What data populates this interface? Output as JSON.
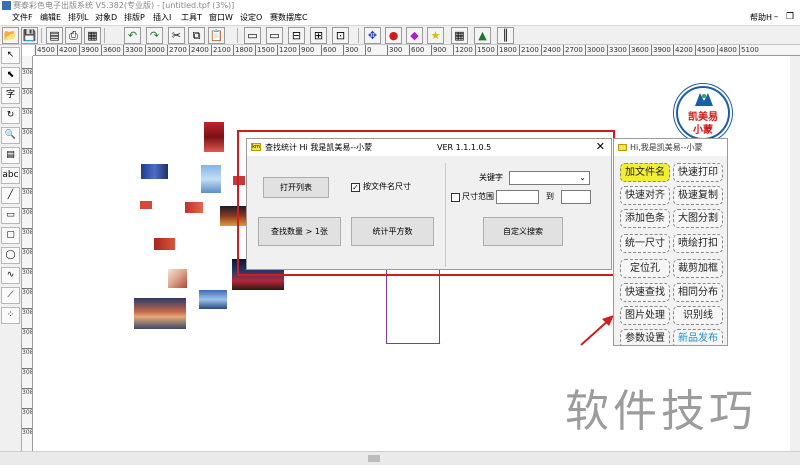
{
  "window": {
    "title": "赛泰彩色电子出版系统 V5.382(专业版) - [untitled.tpf (3%)]",
    "help_menu": "帮助H"
  },
  "menu": [
    "文件F",
    "编辑E",
    "排列L",
    "对象D",
    "排版P",
    "插入I",
    "工具T",
    "窗口W",
    "设定O",
    "赛数摆库C"
  ],
  "toolbar_icons": [
    "open-icon",
    "save-icon",
    "print-preview-icon",
    "print-icon",
    "undo-icon",
    "redo-icon",
    "cut-icon",
    "copy-icon",
    "paste-icon",
    "group-icon",
    "ungroup-icon",
    "align-icon",
    "arrange-icon",
    "move-icon",
    "color-icon",
    "fill-icon",
    "star-icon",
    "table-icon",
    "image-icon",
    "barcode-icon"
  ],
  "ruler": {
    "h_ticks": [
      "4500",
      "4200",
      "3900",
      "3600",
      "3300",
      "3000",
      "2700",
      "2400",
      "2100",
      "1800",
      "1500",
      "1200",
      "900",
      "600",
      "300",
      "0",
      "300",
      "600",
      "900",
      "1200",
      "1500",
      "1800",
      "2100",
      "2400",
      "2700",
      "3000",
      "3300",
      "3600",
      "3900",
      "4200",
      "4500",
      "4800",
      "5100"
    ],
    "v_ticks": [
      "308",
      "308",
      "308",
      "308",
      "308",
      "308",
      "308",
      "308",
      "308",
      "308",
      "308",
      "308",
      "308",
      "308",
      "308",
      "308",
      "308",
      "308",
      "308",
      "308"
    ]
  },
  "left_tools": [
    "arrow-icon",
    "select-icon",
    "text-icon",
    "rotate-icon",
    "zoom-icon",
    "page-icon",
    "abc-text-icon",
    "line-icon",
    "rectangle-icon",
    "rounded-rect-icon",
    "ellipse-icon",
    "wave-icon",
    "polyline-icon",
    "dotted-icon"
  ],
  "dialog": {
    "title": "查找统计 Hi 我是凯美易--小蒙",
    "version": "VER 1.1.1.0.5",
    "open_list_button": "打开列表",
    "by_filename_checkbox": "按文件名尺寸",
    "by_filename_checked": true,
    "count_button": "查找数量 > 1张",
    "area_button": "统计平方数",
    "keyword_label": "关键字",
    "keyword_value": "",
    "size_range_label": "尺寸范围 mm",
    "size_range_checked": false,
    "to_label": "到",
    "custom_search_button": "自定义搜索"
  },
  "panel": {
    "title": "Hi,我是凯美易--小蒙",
    "buttons": [
      {
        "label": "加文件名",
        "highlight": true
      },
      {
        "label": "快速打印"
      },
      {
        "label": "快速对齐"
      },
      {
        "label": "极速复制"
      },
      {
        "label": "添加色条"
      },
      {
        "label": "大图分割"
      },
      {
        "label": "统一尺寸"
      },
      {
        "label": "喷绘打扣"
      },
      {
        "label": "定位孔"
      },
      {
        "label": "裁剪加框"
      },
      {
        "label": "快速查找"
      },
      {
        "label": "相同分布"
      },
      {
        "label": "图片处理"
      },
      {
        "label": "识别线"
      },
      {
        "label": "参数设置"
      },
      {
        "label": "新品发布",
        "blue": true
      }
    ]
  },
  "logo": {
    "line1": "凯美易",
    "line2": "小蒙"
  },
  "watermark": "软件技巧",
  "colors": {
    "accent_red": "#d51c1c",
    "highlight_yellow": "#f1ee34",
    "link_blue": "#1f8fd0"
  }
}
